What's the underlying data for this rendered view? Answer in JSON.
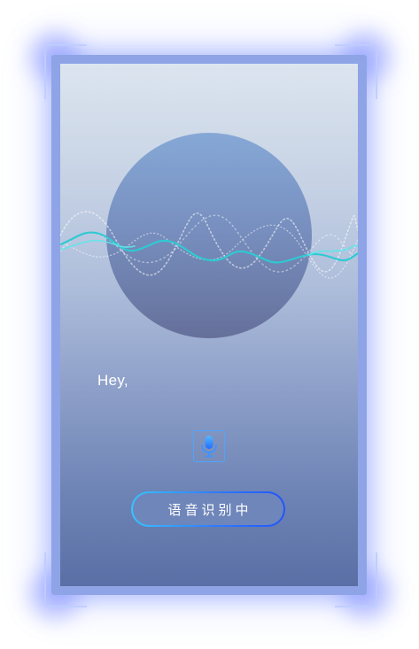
{
  "screen": {
    "greeting": "Hey,",
    "status_label": "语音识别中"
  },
  "icons": {
    "mic": "microphone-icon"
  },
  "colors": {
    "frame": "#8ea4e6",
    "glow": "#7083ff",
    "orb_top": "#86a8d6",
    "orb_bottom": "#65709a",
    "wave_primary": "#2fc9d2",
    "wave_accent": "#5ee6ea",
    "pill_border_start": "#37c3ff",
    "pill_border_end": "#1f55ff",
    "mic_accent": "#4da6ff"
  }
}
